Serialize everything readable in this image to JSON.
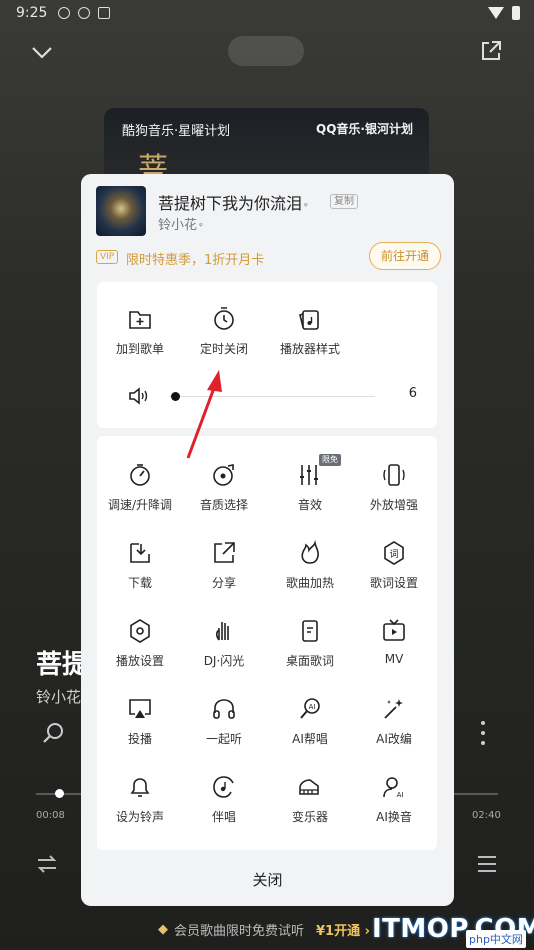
{
  "status": {
    "time": "9:25"
  },
  "album": {
    "left_text": "酷狗音乐·星曜计划",
    "right_text": "QQ音乐·银河计划",
    "big_char": "菩"
  },
  "player": {
    "title": "菩提",
    "artist": "铃小花",
    "time_current": "00:08",
    "time_total": "02:40"
  },
  "banner": {
    "text": "会员歌曲限时免费试听",
    "price": "¥1开通 ›"
  },
  "watermark": {
    "main": "ITMOP.COM",
    "sub": "php中文网"
  },
  "sheet": {
    "song_title": "菩提树下我为你流泪",
    "copy_label": "复制",
    "artist": "铃小花",
    "vip_badge": "VIP",
    "vip_text": "限时特惠季，1折开月卡",
    "vip_button": "前往开通",
    "top_items": [
      {
        "label": "加到歌单",
        "icon": "add-to-playlist-icon"
      },
      {
        "label": "定时关闭",
        "icon": "timer-icon"
      },
      {
        "label": "播放器样式",
        "icon": "player-style-icon"
      }
    ],
    "volume_value": "6",
    "volume_level": 0.03,
    "grid_items": [
      {
        "label": "调速/升降调",
        "icon": "speed-icon"
      },
      {
        "label": "音质选择",
        "icon": "quality-icon"
      },
      {
        "label": "音效",
        "icon": "equalizer-icon",
        "tag": "限免"
      },
      {
        "label": "外放增强",
        "icon": "speaker-boost-icon"
      },
      {
        "label": "下载",
        "icon": "download-icon"
      },
      {
        "label": "分享",
        "icon": "share-icon"
      },
      {
        "label": "歌曲加热",
        "icon": "fire-icon"
      },
      {
        "label": "歌词设置",
        "icon": "lyrics-setting-icon"
      },
      {
        "label": "播放设置",
        "icon": "play-setting-icon"
      },
      {
        "label": "DJ·闪光",
        "icon": "dj-flash-icon"
      },
      {
        "label": "桌面歌词",
        "icon": "desktop-lyrics-icon"
      },
      {
        "label": "MV",
        "icon": "mv-icon"
      },
      {
        "label": "投播",
        "icon": "cast-icon"
      },
      {
        "label": "一起听",
        "icon": "listen-together-icon"
      },
      {
        "label": "AI帮唱",
        "icon": "ai-sing-icon"
      },
      {
        "label": "AI改编",
        "icon": "ai-remix-icon"
      },
      {
        "label": "设为铃声",
        "icon": "ringtone-icon"
      },
      {
        "label": "伴唱",
        "icon": "accompany-icon"
      },
      {
        "label": "变乐器",
        "icon": "instrument-icon"
      },
      {
        "label": "AI换音",
        "icon": "ai-voice-icon"
      }
    ],
    "close_label": "关闭"
  },
  "colors": {
    "accent_gold": "#d49a37",
    "arrow_red": "#e0202a"
  }
}
